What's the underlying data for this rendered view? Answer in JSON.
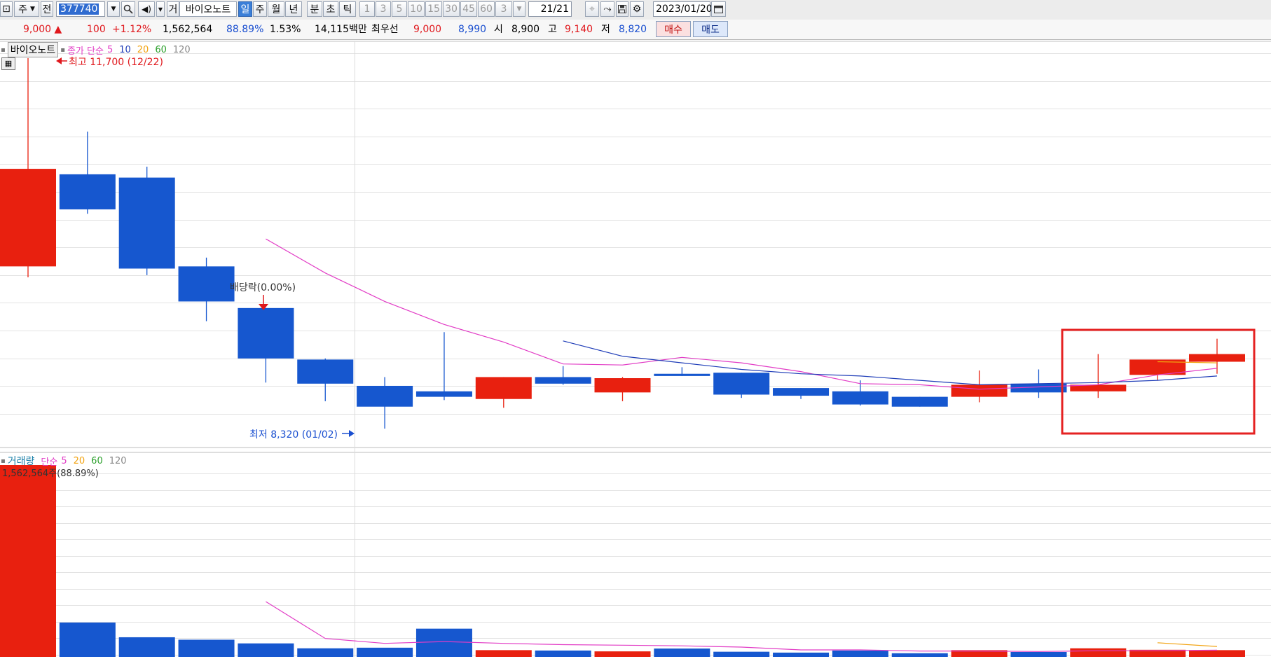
{
  "toolbar": {
    "market": "주",
    "prev_label": "전",
    "code": "377740",
    "market_tag": "거",
    "stock_name": "바이오노트",
    "periods": [
      "일",
      "주",
      "월",
      "년",
      "분",
      "초",
      "틱"
    ],
    "selected_period": "일",
    "intervals": [
      "1",
      "3",
      "5",
      "10",
      "15",
      "30",
      "45",
      "60"
    ],
    "custom_interval": "3",
    "count": "21",
    "count_total": "/21",
    "date": "2023/01/20"
  },
  "quote": {
    "price": "9,000",
    "change": "100",
    "change_pct": "+1.12%",
    "volume": "1,562,564",
    "volume_ratio": "88.89%",
    "turnover": "1.53%",
    "amount": "14,115백만",
    "best_label": "최우선",
    "best_ask": "9,000",
    "best_bid": "8,990",
    "open_label": "시",
    "open": "8,900",
    "high_label": "고",
    "high": "9,140",
    "low_label": "저",
    "low": "8,820",
    "buy_label": "매수",
    "sell_label": "매도"
  },
  "colors": {
    "up": "#e8200f",
    "down": "#1657cf",
    "ma5": "#e23dc6",
    "ma10": "#1f3db8",
    "ma20": "#f2a311",
    "ma60": "#2ca02c",
    "ma120": "#888888",
    "highlight": "#e52222"
  },
  "price_panel": {
    "name_tag": "바이오노트",
    "legend_name": "종가 단순",
    "periods": [
      "5",
      "10",
      "20",
      "60",
      "120"
    ],
    "high_annotation": "최고 11,700 (12/22)",
    "low_annotation": "최저 8,320 (01/02)",
    "event_annotation": "배당락(0.00%)"
  },
  "volume_panel": {
    "legend_name": "거래량",
    "legend_sub": "단순",
    "periods": [
      "5",
      "20",
      "60",
      "120"
    ],
    "first_bar_label": "1,562,564주(88.89%)"
  },
  "chart_data": {
    "type": "candlestick",
    "candles": [
      {
        "o": 9800,
        "h": 11700,
        "l": 9700,
        "c": 10690
      },
      {
        "o": 10640,
        "h": 11030,
        "l": 10280,
        "c": 10320
      },
      {
        "o": 10610,
        "h": 10710,
        "l": 9720,
        "c": 9780
      },
      {
        "o": 9800,
        "h": 9880,
        "l": 9300,
        "c": 9480
      },
      {
        "o": 9420,
        "h": 9420,
        "l": 8740,
        "c": 8960
      },
      {
        "o": 8950,
        "h": 8960,
        "l": 8570,
        "c": 8730
      },
      {
        "o": 8710,
        "h": 8790,
        "l": 8320,
        "c": 8520
      },
      {
        "o": 8660,
        "h": 9200,
        "l": 8580,
        "c": 8610
      },
      {
        "o": 8590,
        "h": 8790,
        "l": 8510,
        "c": 8790
      },
      {
        "o": 8790,
        "h": 8890,
        "l": 8720,
        "c": 8730
      },
      {
        "o": 8650,
        "h": 8790,
        "l": 8570,
        "c": 8780
      },
      {
        "o": 8820,
        "h": 8880,
        "l": 8800,
        "c": 8800
      },
      {
        "o": 8830,
        "h": 8830,
        "l": 8600,
        "c": 8630
      },
      {
        "o": 8690,
        "h": 8690,
        "l": 8590,
        "c": 8620
      },
      {
        "o": 8660,
        "h": 8760,
        "l": 8530,
        "c": 8540
      },
      {
        "o": 8610,
        "h": 8610,
        "l": 8520,
        "c": 8520
      },
      {
        "o": 8610,
        "h": 8850,
        "l": 8560,
        "c": 8720
      },
      {
        "o": 8730,
        "h": 8860,
        "l": 8600,
        "c": 8650
      },
      {
        "o": 8660,
        "h": 9000,
        "l": 8600,
        "c": 8720
      },
      {
        "o": 8810,
        "h": 8940,
        "l": 8760,
        "c": 8950
      },
      {
        "o": 8930,
        "h": 9140,
        "l": 8820,
        "c": 9000
      }
    ],
    "volume": [
      1562564,
      280000,
      160000,
      140000,
      110000,
      70000,
      75000,
      230000,
      55000,
      52000,
      45000,
      68000,
      42000,
      35000,
      52000,
      30000,
      55000,
      40000,
      70000,
      58000,
      55000
    ],
    "ma5": [
      null,
      null,
      null,
      null,
      10050,
      9740,
      9480,
      9270,
      9110,
      8910,
      8900,
      8970,
      8920,
      8840,
      8730,
      8720,
      8680,
      8700,
      8720,
      8810,
      8870
    ],
    "ma10": [
      null,
      null,
      null,
      null,
      null,
      null,
      null,
      null,
      null,
      9120,
      8980,
      8920,
      8860,
      8820,
      8800,
      8760,
      8720,
      8730,
      8740,
      8760,
      8800
    ],
    "ma20": [
      null,
      null,
      null,
      null,
      null,
      null,
      null,
      null,
      null,
      null,
      null,
      null,
      null,
      null,
      null,
      null,
      null,
      null,
      null,
      8930,
      8920
    ],
    "vol_ma5": [
      null,
      null,
      null,
      null,
      450000,
      150000,
      110000,
      125000,
      110000,
      100000,
      95000,
      90000,
      80000,
      57000,
      57000,
      48000,
      48000,
      44000,
      50000,
      50000,
      55000
    ],
    "vol_ma20": [
      null,
      null,
      null,
      null,
      null,
      null,
      null,
      null,
      null,
      null,
      null,
      null,
      null,
      null,
      null,
      null,
      null,
      null,
      null,
      115000,
      85000
    ]
  }
}
